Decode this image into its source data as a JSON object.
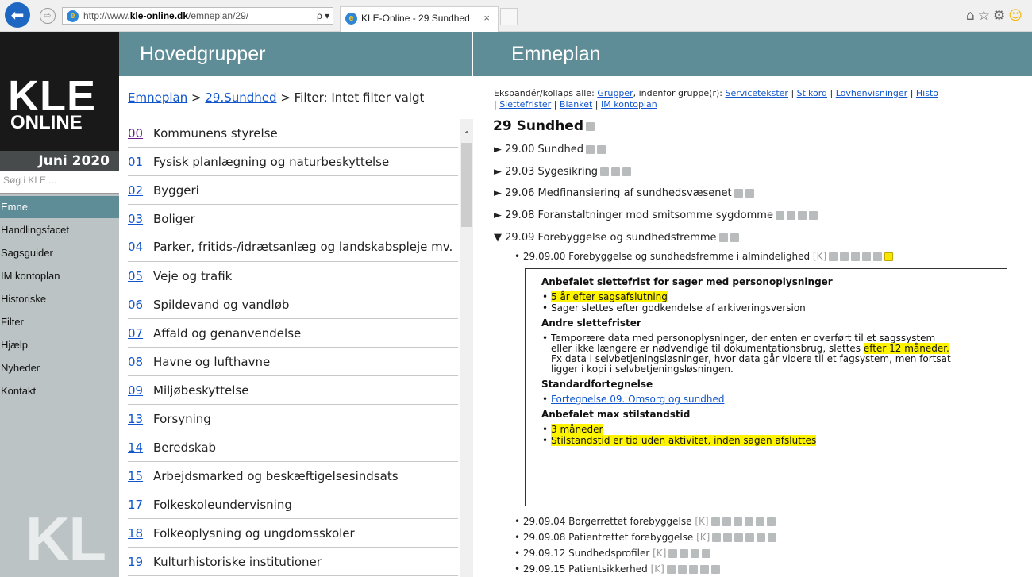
{
  "browser": {
    "url_prefix": "http://www.",
    "url_domain": "kle-online.dk",
    "url_path": "/emneplan/29/",
    "search_glyph": "ρ ▾ ↻",
    "tab_title": "KLE-Online - 29 Sundhed",
    "tab_close": "×",
    "back_glyph": "⬅",
    "forward_glyph": "⇨",
    "ie_glyph": "e",
    "toolbar_icons": [
      "home-icon",
      "favorites-icon",
      "settings-icon",
      "feedback-icon"
    ]
  },
  "sidebar": {
    "logo_line1": "KLE",
    "logo_line2": "ONLINE",
    "edition": "Juni 2020",
    "search_placeholder": "Søg i KLE ...",
    "menu": [
      "Emne",
      "Handlingsfacet",
      "Sagsguider",
      "IM kontoplan",
      "Historiske",
      "Filter",
      "Hjælp",
      "Nyheder",
      "Kontakt"
    ],
    "active_menu": "Emne",
    "footer_logo": "KL"
  },
  "middle": {
    "header": "Hovedgrupper",
    "crumb_link1": "Emneplan",
    "crumb_sep": ">",
    "crumb_link2": "29.Sundhed",
    "crumb_filter": "> Filter: Intet filter valgt",
    "groups": [
      {
        "code": "00",
        "title": "Kommunens styrelse"
      },
      {
        "code": "01",
        "title": "Fysisk planlægning og naturbeskyttelse"
      },
      {
        "code": "02",
        "title": "Byggeri"
      },
      {
        "code": "03",
        "title": "Boliger"
      },
      {
        "code": "04",
        "title": "Parker, fritids-/idrætsanlæg og landskabspleje mv."
      },
      {
        "code": "05",
        "title": "Veje og trafik"
      },
      {
        "code": "06",
        "title": "Spildevand og vandløb"
      },
      {
        "code": "07",
        "title": "Affald og genanvendelse"
      },
      {
        "code": "08",
        "title": "Havne og lufthavne"
      },
      {
        "code": "09",
        "title": "Miljøbeskyttelse"
      },
      {
        "code": "13",
        "title": "Forsyning"
      },
      {
        "code": "14",
        "title": "Beredskab"
      },
      {
        "code": "15",
        "title": "Arbejdsmarked og beskæftigelsesindsats"
      },
      {
        "code": "17",
        "title": "Folkeskoleundervisning"
      },
      {
        "code": "18",
        "title": "Folkeoplysning og ungdomsskoler"
      },
      {
        "code": "19",
        "title": "Kulturhistoriske institutioner"
      }
    ]
  },
  "right": {
    "header": "Emneplan",
    "expand_label": "Ekspandér/kollaps alle:",
    "expand_grupper": "Grupper",
    "expand_mid": ", indenfor gruppe(r):",
    "expand_links": [
      "Servicetekster",
      "Stikord",
      "Lovhenvisninger",
      "Histo",
      "Slettefrister",
      "Blanket",
      "IM kontoplan"
    ],
    "title": "29 Sundhed",
    "items": [
      {
        "arrow": "►",
        "code": "29.00",
        "title": "Sundhed"
      },
      {
        "arrow": "►",
        "code": "29.03",
        "title": "Sygesikring"
      },
      {
        "arrow": "►",
        "code": "29.06",
        "title": "Medfinansiering af sundhedsvæsenet"
      },
      {
        "arrow": "►",
        "code": "29.08",
        "title": "Foranstaltninger mod smitsomme sygdomme"
      },
      {
        "arrow": "▼",
        "code": "29.09",
        "title": "Forebyggelse og sundhedsfremme"
      }
    ],
    "subitems": [
      {
        "code": "29.09.00",
        "title": "Forebyggelse og sundhedsfremme i almindelighed"
      },
      {
        "code": "29.09.04",
        "title": "Borgerrettet forebyggelse"
      },
      {
        "code": "29.09.08",
        "title": "Patientrettet forebyggelse"
      },
      {
        "code": "29.09.12",
        "title": "Sundhedsprofiler"
      },
      {
        "code": "29.09.15",
        "title": "Patientsikkerhed"
      }
    ],
    "k_tag": "[K]",
    "detail": {
      "h1": "Anbefalet slettefrist for sager med personoplysninger",
      "b1": "5 år efter sagsafslutning",
      "b2": "Sager slettes efter godkendelse af arkiveringsversion",
      "h2": "Andre slettefrister",
      "b3_line1a": "Temporære data med personoplysninger, der enten er overført til et sagssystem",
      "b3_line2a": "eller ikke længere er nødvendige til dokumentationsbrug, slettes ",
      "b3_line2b": "efter 12 måneder.",
      "b3_line3": "Fx data i selvbetjeningsløsninger, hvor data går videre til et fagsystem, men fortsat",
      "b3_line4": "ligger i kopi i selvbetjeningsløsningen.",
      "h3": "Standardfortegnelse",
      "b4": "Fortegnelse 09. Omsorg og sundhed",
      "h4": "Anbefalet max stilstandstid",
      "b5": "3 måneder",
      "b6": "Stilstandstid er tid uden aktivitet, inden sagen afsluttes"
    }
  }
}
